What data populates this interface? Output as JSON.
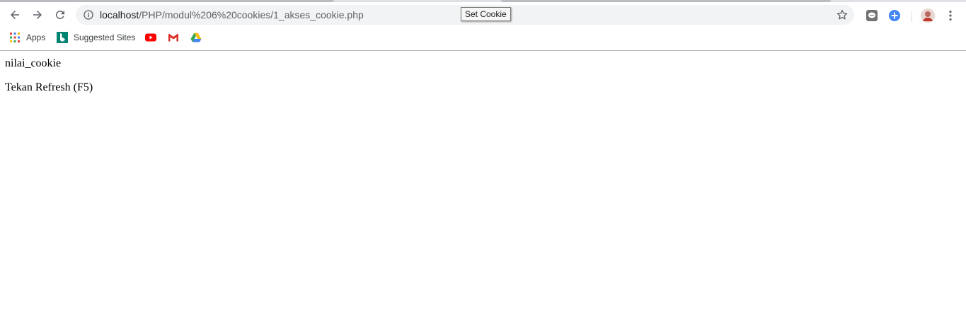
{
  "browser": {
    "url_host": "localhost",
    "url_path": "/PHP/modul%206%20cookies/1_akses_cookie.php",
    "tab_tooltip": "Set Cookie",
    "icons": {
      "back": "arrow-left-icon",
      "forward": "arrow-right-icon",
      "reload": "reload-icon",
      "site_info": "info-icon",
      "bookmark_star": "star-icon",
      "extension_1": "chat-extension-icon",
      "extension_2": "plus-circle-icon",
      "profile": "avatar",
      "menu": "kebab-menu-icon"
    }
  },
  "bookmarks": {
    "items": [
      {
        "label": "Apps",
        "icon": "apps-grid-icon"
      },
      {
        "label": "Suggested Sites",
        "icon": "bing-icon"
      },
      {
        "label": "",
        "icon": "youtube-icon"
      },
      {
        "label": "",
        "icon": "gmail-icon"
      },
      {
        "label": "",
        "icon": "google-drive-icon"
      }
    ]
  },
  "page": {
    "line1": "nilai_cookie",
    "line2": "Tekan Refresh (F5)"
  },
  "colors": {
    "omnibox_bg": "#f1f3f4",
    "page_bg": "#ffffff",
    "icon_gray": "#5f6368",
    "extension_blue": "#4285f4"
  }
}
